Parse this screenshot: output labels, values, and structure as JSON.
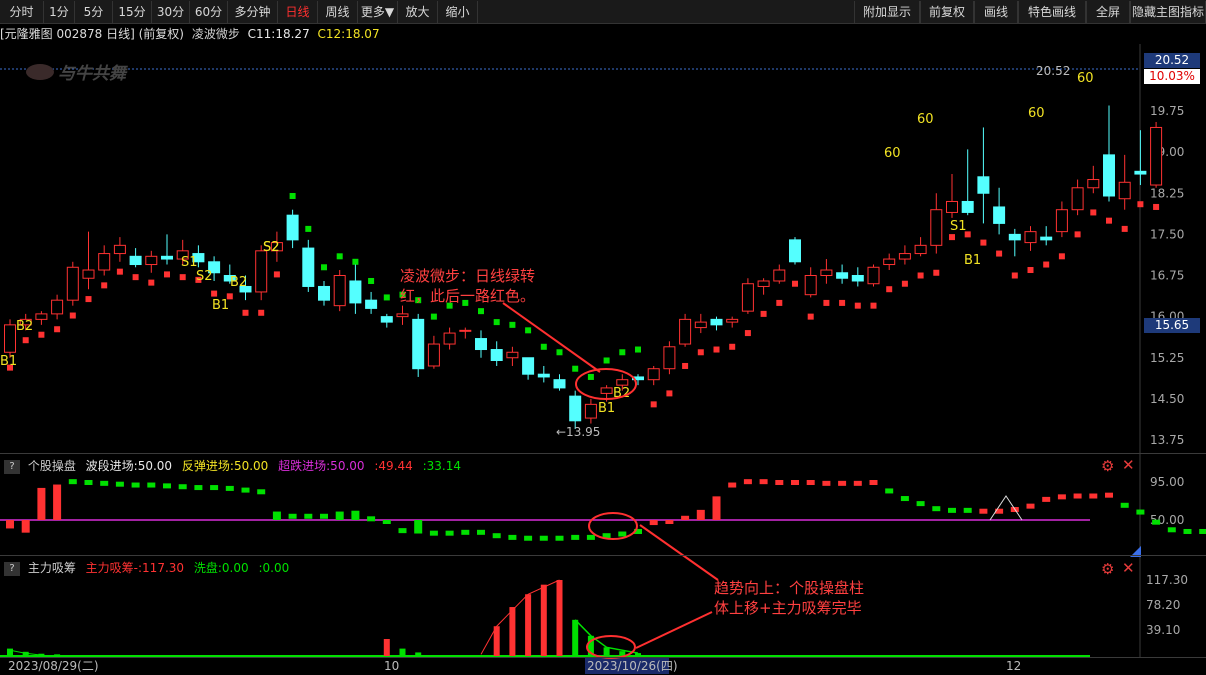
{
  "toolbar": {
    "left": [
      "分时",
      "1分",
      "5分",
      "15分",
      "30分",
      "60分",
      "多分钟",
      "日线",
      "周线",
      "更多▼",
      "放大",
      "缩小"
    ],
    "active": "日线",
    "right": [
      "附加显示",
      "前复权",
      "画线",
      "特色画线",
      "全屏",
      "隐藏主图指标"
    ]
  },
  "info": {
    "stock": "[元隆雅图 002878 日线] (前复权)",
    "indicator": "凌波微步",
    "c1": "C11:18.27",
    "c2": "C12:18.07"
  },
  "watermark": "与牛共舞",
  "axis": {
    "price_ticks": [
      "19.75",
      "19.00",
      "18.25",
      "17.50",
      "16.75",
      "16.00",
      "15.25",
      "14.50",
      "13.75"
    ],
    "limit_price": "20.52",
    "limit_pct": "10.03%",
    "current_price": "15.65",
    "osc_ticks": [
      "95.00",
      "50.00"
    ],
    "vol_ticks": [
      "117.30",
      "78.20",
      "39.10"
    ],
    "dates": [
      "2023/08/29(二)",
      "10",
      "2023/10/26(四)",
      "12"
    ]
  },
  "price_annotations": {
    "high": "20.52",
    "low": "13.95"
  },
  "signals": [
    "B1",
    "B2",
    "S1",
    "S2",
    "S2",
    "B2",
    "B1",
    "S2",
    "B1",
    "B2",
    "60",
    "60",
    "S1",
    "B1",
    "60",
    "60"
  ],
  "annotations": {
    "top": [
      "凌波微步：日线绿转",
      "红，此后一路红色。"
    ],
    "bottom": [
      "趋势向上：个股操盘柱",
      "体上移+主力吸筹完毕"
    ]
  },
  "osc_panel": {
    "title": "个股操盘",
    "v1": "波段进场:50.00",
    "v2": "反弹进场:50.00",
    "v3": "超跌进场:50.00",
    "v4": ":49.44",
    "v5": ":33.14"
  },
  "vol_panel": {
    "title": "主力吸筹",
    "v1": "主力吸筹-:117.30",
    "v2": "洗盘:0.00",
    "v3": ":0.00"
  },
  "colors": {
    "up": "#ff3232",
    "down": "#54ffff",
    "green": "#00e000",
    "yellow": "#f2e324",
    "magenta": "#d92ed9"
  },
  "chart_data": {
    "type": "candlestick",
    "ohlc": [
      [
        15.35,
        15.95,
        15.25,
        15.85
      ],
      [
        15.85,
        16.05,
        15.75,
        15.95
      ],
      [
        15.95,
        16.1,
        15.85,
        16.05
      ],
      [
        16.05,
        16.4,
        15.95,
        16.3
      ],
      [
        16.3,
        17.0,
        16.2,
        16.9
      ],
      [
        16.7,
        17.55,
        16.5,
        16.85
      ],
      [
        16.85,
        17.3,
        16.75,
        17.15
      ],
      [
        17.15,
        17.45,
        17.0,
        17.3
      ],
      [
        17.1,
        17.25,
        16.9,
        16.95
      ],
      [
        16.95,
        17.2,
        16.8,
        17.1
      ],
      [
        17.1,
        17.5,
        16.95,
        17.05
      ],
      [
        17.05,
        17.4,
        16.95,
        17.2
      ],
      [
        17.15,
        17.3,
        16.9,
        17.0
      ],
      [
        17.0,
        17.1,
        16.65,
        16.8
      ],
      [
        16.75,
        16.95,
        16.6,
        16.65
      ],
      [
        16.55,
        16.75,
        16.3,
        16.45
      ],
      [
        16.45,
        17.3,
        16.3,
        17.2
      ],
      [
        17.2,
        17.55,
        17.0,
        17.35
      ],
      [
        17.85,
        17.95,
        17.25,
        17.4
      ],
      [
        17.25,
        17.4,
        16.45,
        16.55
      ],
      [
        16.55,
        16.65,
        16.2,
        16.3
      ],
      [
        16.2,
        16.85,
        16.1,
        16.75
      ],
      [
        16.65,
        16.95,
        16.05,
        16.25
      ],
      [
        16.3,
        16.45,
        16.05,
        16.15
      ],
      [
        16.0,
        16.05,
        15.8,
        15.9
      ],
      [
        16.0,
        16.2,
        15.85,
        16.05
      ],
      [
        15.95,
        16.05,
        14.9,
        15.05
      ],
      [
        15.1,
        15.65,
        15.05,
        15.5
      ],
      [
        15.5,
        15.8,
        15.4,
        15.7
      ],
      [
        15.75,
        15.8,
        15.6,
        15.75
      ],
      [
        15.6,
        15.75,
        15.25,
        15.4
      ],
      [
        15.4,
        15.55,
        15.1,
        15.2
      ],
      [
        15.25,
        15.45,
        15.1,
        15.35
      ],
      [
        15.25,
        15.25,
        14.85,
        14.95
      ],
      [
        14.95,
        15.1,
        14.8,
        14.9
      ],
      [
        14.85,
        14.95,
        14.65,
        14.7
      ],
      [
        14.55,
        14.65,
        13.95,
        14.1
      ],
      [
        14.15,
        14.5,
        14.05,
        14.4
      ],
      [
        14.6,
        14.75,
        14.45,
        14.7
      ],
      [
        14.75,
        14.95,
        14.65,
        14.85
      ],
      [
        14.9,
        14.95,
        14.75,
        14.85
      ],
      [
        14.85,
        15.1,
        14.75,
        15.05
      ],
      [
        15.05,
        15.55,
        14.95,
        15.45
      ],
      [
        15.5,
        16.05,
        15.45,
        15.95
      ],
      [
        15.8,
        16.05,
        15.7,
        15.9
      ],
      [
        15.95,
        16.0,
        15.75,
        15.85
      ],
      [
        15.9,
        16.0,
        15.8,
        15.95
      ],
      [
        16.1,
        16.7,
        16.05,
        16.6
      ],
      [
        16.55,
        16.7,
        16.4,
        16.65
      ],
      [
        16.65,
        16.95,
        16.6,
        16.85
      ],
      [
        17.4,
        17.45,
        16.95,
        17.0
      ],
      [
        16.4,
        16.9,
        16.35,
        16.75
      ],
      [
        16.75,
        17.05,
        16.6,
        16.85
      ],
      [
        16.8,
        16.95,
        16.6,
        16.7
      ],
      [
        16.75,
        16.9,
        16.55,
        16.65
      ],
      [
        16.6,
        16.95,
        16.55,
        16.9
      ],
      [
        16.95,
        17.15,
        16.85,
        17.05
      ],
      [
        17.05,
        17.3,
        16.95,
        17.15
      ],
      [
        17.15,
        17.45,
        17.1,
        17.3
      ],
      [
        17.3,
        18.25,
        17.15,
        17.95
      ],
      [
        17.9,
        18.6,
        17.8,
        18.1
      ],
      [
        18.1,
        19.05,
        17.85,
        17.9
      ],
      [
        18.55,
        19.45,
        17.7,
        18.25
      ],
      [
        18.0,
        18.35,
        17.5,
        17.7
      ],
      [
        17.5,
        17.6,
        17.1,
        17.4
      ],
      [
        17.35,
        17.65,
        17.2,
        17.55
      ],
      [
        17.45,
        17.65,
        17.3,
        17.4
      ],
      [
        17.55,
        18.1,
        17.45,
        17.95
      ],
      [
        17.95,
        18.5,
        17.85,
        18.35
      ],
      [
        18.35,
        18.75,
        18.25,
        18.5
      ],
      [
        18.95,
        19.85,
        18.1,
        18.2
      ],
      [
        18.15,
        18.95,
        17.95,
        18.45
      ],
      [
        18.65,
        19.4,
        18.4,
        18.6
      ],
      [
        18.4,
        19.55,
        18.35,
        19.45
      ]
    ],
    "ylim": [
      13.6,
      20.6
    ]
  }
}
